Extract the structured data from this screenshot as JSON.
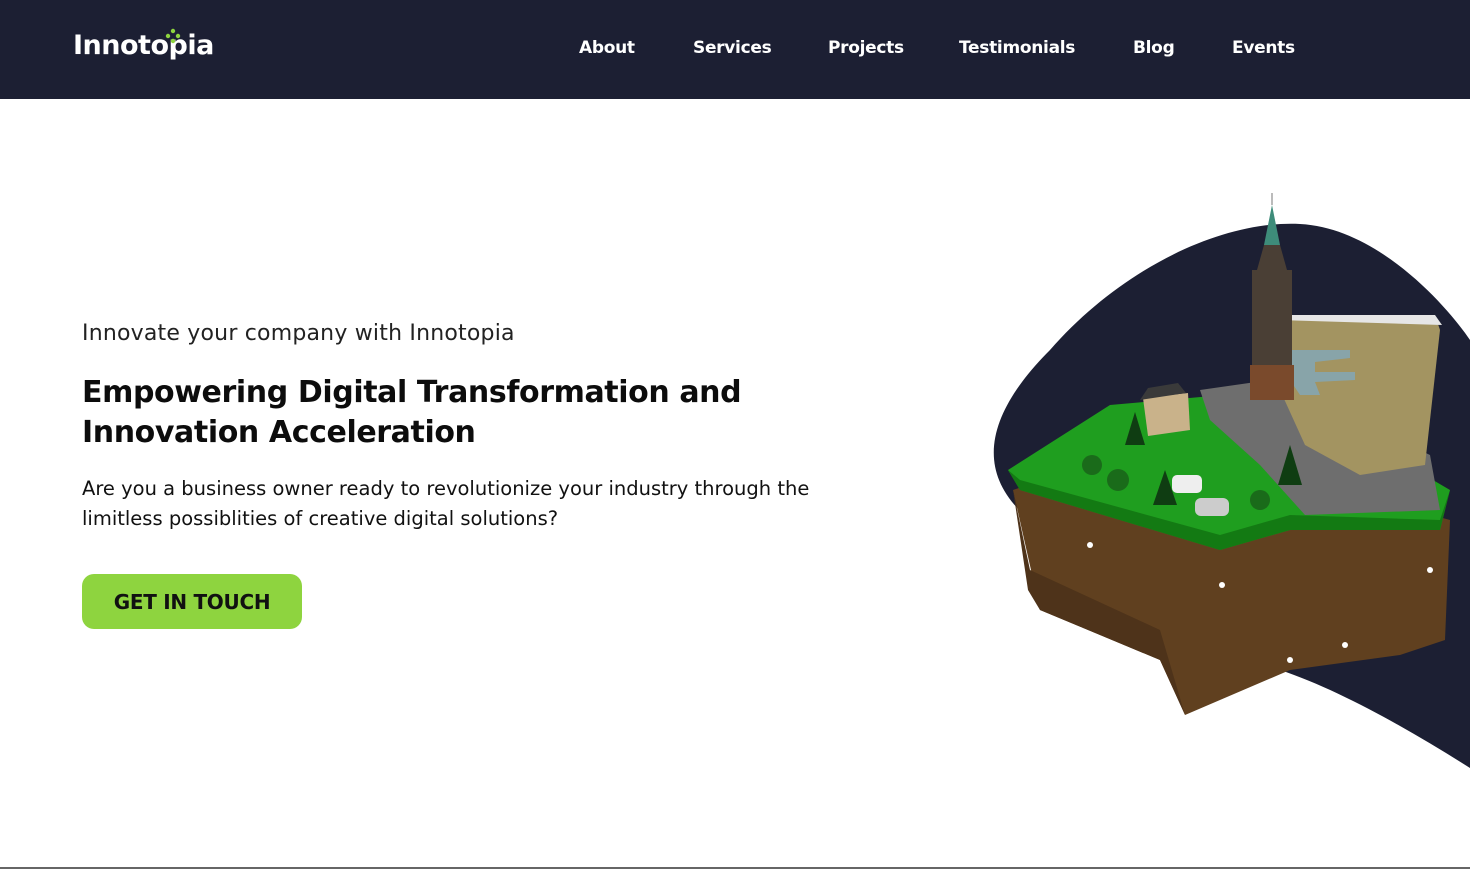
{
  "header": {
    "logo_text": "Innotopia",
    "nav": [
      {
        "label": "About"
      },
      {
        "label": "Services"
      },
      {
        "label": "Projects"
      },
      {
        "label": "Testimonials"
      },
      {
        "label": "Blog"
      },
      {
        "label": "Events"
      }
    ]
  },
  "hero": {
    "tagline": "Innovate your company with Innotopia",
    "headline_line1": "Empowering Digital Transformation and",
    "headline_line2": "Innovation Acceleration",
    "description_line1": "Are you a business owner ready to revolutionize your industry through the",
    "description_line2": "limitless possiblities of creative digital solutions?",
    "cta_label": "GET IN TOUCH"
  },
  "colors": {
    "navbar_bg": "#1c1f33",
    "accent_green": "#8ed43f",
    "blob_navy": "#1c1f33"
  },
  "illustration": {
    "icon": "floating-island-city-illustration"
  }
}
